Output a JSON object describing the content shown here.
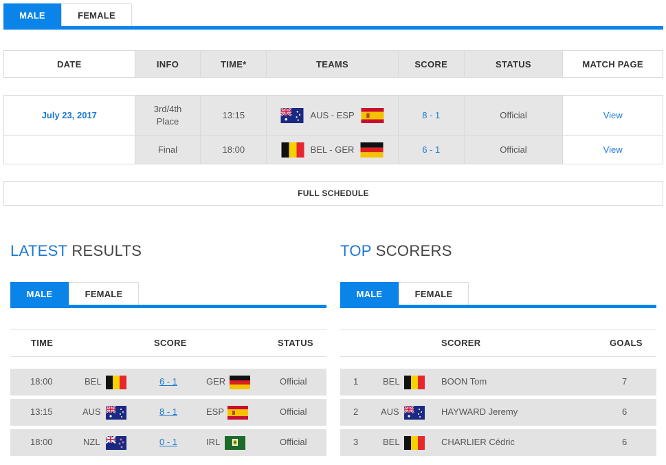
{
  "top_tabs": {
    "male": "MALE",
    "female": "FEMALE"
  },
  "schedule": {
    "headers": {
      "date": "DATE",
      "info": "INFO",
      "time": "TIME*",
      "teams": "TEAMS",
      "score": "SCORE",
      "status": "STATUS",
      "match_page": "MATCH PAGE"
    },
    "rows": [
      {
        "date": "July 23, 2017",
        "info": "3rd/4th Place",
        "time": "13:15",
        "teams": "AUS - ESP",
        "home_flag": "australia-flag",
        "away_flag": "spain-flag",
        "score": "8 - 1",
        "status": "Official",
        "link": "View"
      },
      {
        "date": "",
        "info": "Final",
        "time": "18:00",
        "teams": "BEL - GER",
        "home_flag": "belgium-flag",
        "away_flag": "germany-flag",
        "score": "6 - 1",
        "status": "Official",
        "link": "View"
      }
    ],
    "full_schedule": "FULL SCHEDULE"
  },
  "latest_results": {
    "title_highlight": "LATEST",
    "title_rest": "RESULTS",
    "tabs": {
      "male": "MALE",
      "female": "FEMALE"
    },
    "headers": {
      "time": "TIME",
      "score": "SCORE",
      "status": "STATUS"
    },
    "rows": [
      {
        "time": "18:00",
        "home": "BEL",
        "home_flag": "belgium-flag",
        "score": "6 - 1",
        "away": "GER",
        "away_flag": "germany-flag",
        "status": "Official"
      },
      {
        "time": "13:15",
        "home": "AUS",
        "home_flag": "australia-flag",
        "score": "8 - 1",
        "away": "ESP",
        "away_flag": "spain-flag",
        "status": "Official"
      },
      {
        "time": "18:00",
        "home": "NZL",
        "home_flag": "new-zealand-flag",
        "score": "0 - 1",
        "away": "IRL",
        "away_flag": "ireland-hockey-flag",
        "status": "Official"
      }
    ]
  },
  "top_scorers": {
    "title_highlight": "TOP",
    "title_rest": "SCORERS",
    "tabs": {
      "male": "MALE",
      "female": "FEMALE"
    },
    "headers": {
      "scorer": "SCORER",
      "goals": "GOALS"
    },
    "rows": [
      {
        "rank": "1",
        "country": "BEL",
        "flag": "belgium-flag",
        "name": "BOON Tom",
        "goals": "7"
      },
      {
        "rank": "2",
        "country": "AUS",
        "flag": "australia-flag",
        "name": "HAYWARD Jeremy",
        "goals": "6"
      },
      {
        "rank": "3",
        "country": "BEL",
        "flag": "belgium-flag",
        "name": "CHARLIER Cédric",
        "goals": "6"
      }
    ]
  },
  "colors": {
    "accent": "#0a84e8",
    "link": "#1a78d4",
    "row_bg": "#e3e3e3",
    "header_grey": "#e6e6e6"
  }
}
